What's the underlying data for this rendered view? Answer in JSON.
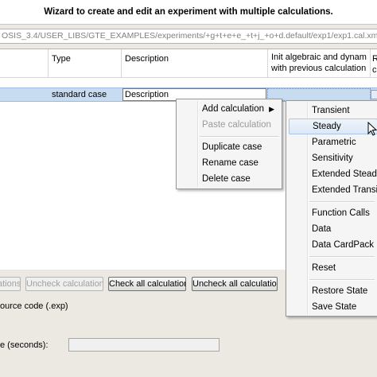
{
  "window": {
    "title": "Wizard to create and edit an experiment with multiple calculations."
  },
  "path": {
    "text": "OSIS_3.4/USER_LIBS/GTE_EXAMPLES/experiments/+g+t+e+e_+t+j_+o+d.default/exp1/exp1.cal.xml"
  },
  "table": {
    "headers": {
      "type": "Type",
      "description": "Description",
      "init": "Init algebraic and dynam with previous calculation",
      "last": "R c"
    },
    "row": {
      "type": "standard case",
      "description": "Description"
    }
  },
  "context_menu": {
    "items": [
      {
        "label": "Add calculation",
        "arrow": "▶"
      },
      {
        "label": "Paste calculation"
      },
      {
        "label": "Duplicate case"
      },
      {
        "label": "Rename case"
      },
      {
        "label": "Delete case"
      }
    ]
  },
  "submenu": {
    "items": [
      "Transient",
      "Steady",
      "Parametric",
      "Sensitivity",
      "Extended Steady",
      "Extended Transient",
      "Function Calls",
      "Data",
      "Data CardPack",
      "Reset",
      "Restore State",
      "Save State"
    ]
  },
  "buttons": {
    "partial_left": "ations",
    "uncheck_calculations": "Uncheck calculations",
    "check_all": "Check all calculations",
    "uncheck_all": "Uncheck all calculations"
  },
  "labels": {
    "source_code": "ource code (.exp)",
    "time_seconds": "e (seconds):"
  }
}
